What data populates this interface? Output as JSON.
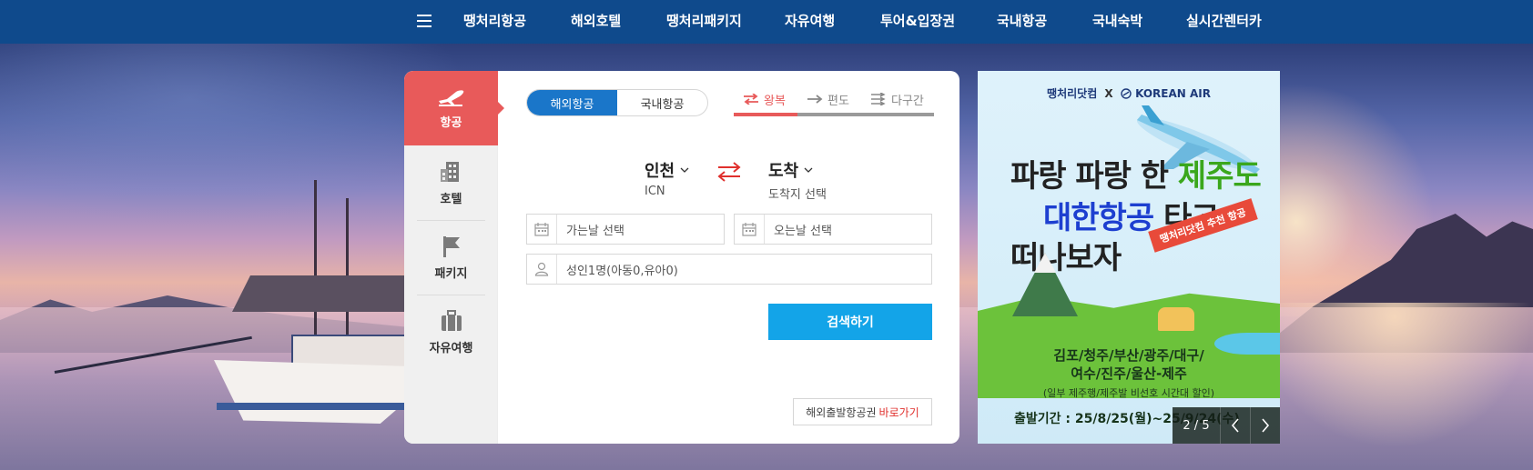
{
  "nav": {
    "items": [
      "땡처리항공",
      "해외호텔",
      "땡처리패키지",
      "자유여행",
      "투어&입장권",
      "국내항공",
      "국내숙박",
      "실시간렌터카"
    ]
  },
  "sidebar": {
    "items": [
      {
        "label": "항공",
        "icon": "airplane-icon",
        "active": true
      },
      {
        "label": "호텔",
        "icon": "hotel-icon",
        "active": false
      },
      {
        "label": "패키지",
        "icon": "flag-icon",
        "active": false
      },
      {
        "label": "자유여행",
        "icon": "suitcase-icon",
        "active": false
      }
    ]
  },
  "flight_type": {
    "options": [
      "해외항공",
      "국내항공"
    ],
    "selected": "해외항공"
  },
  "trip_type": {
    "options": [
      "왕복",
      "편도",
      "다구간"
    ],
    "selected": "왕복"
  },
  "route": {
    "origin": {
      "name": "인천",
      "code": "ICN"
    },
    "destination": {
      "name": "도착",
      "code": "도착지 선택"
    }
  },
  "fields": {
    "depart": "가는날 선택",
    "return": "오는날 선택",
    "passengers": "성인1명(아동0,유아0)"
  },
  "search_button": "검색하기",
  "intl_link": {
    "text": "해외출발항공권",
    "action": "바로가기"
  },
  "banner": {
    "logo_left": "땡처리닷컴",
    "logo_x": "X",
    "logo_right": "KOREAN AIR",
    "line1_a": "파랑 파랑 한 ",
    "line1_b": "제주도",
    "line2_a": "대한항공",
    "line2_b": " 타고",
    "line3": "떠나보자",
    "ribbon": "땡처리닷컴 추천 항공",
    "dests_1": "김포/청주/부산/광주/대구/",
    "dests_2": "여수/진주/울산-제주",
    "note": "(일부 제주행/제주발 비선호 시간대 할인)",
    "period": "출발기간 : 25/8/25(월)~25/9/24(수)"
  },
  "pager": {
    "current": "2",
    "total": "5",
    "text": "2 / 5"
  },
  "colors": {
    "nav_bg": "#0f4a8c",
    "active_red": "#e85a5a",
    "tab_blue": "#1a76c9",
    "search_blue": "#13a4e8"
  }
}
